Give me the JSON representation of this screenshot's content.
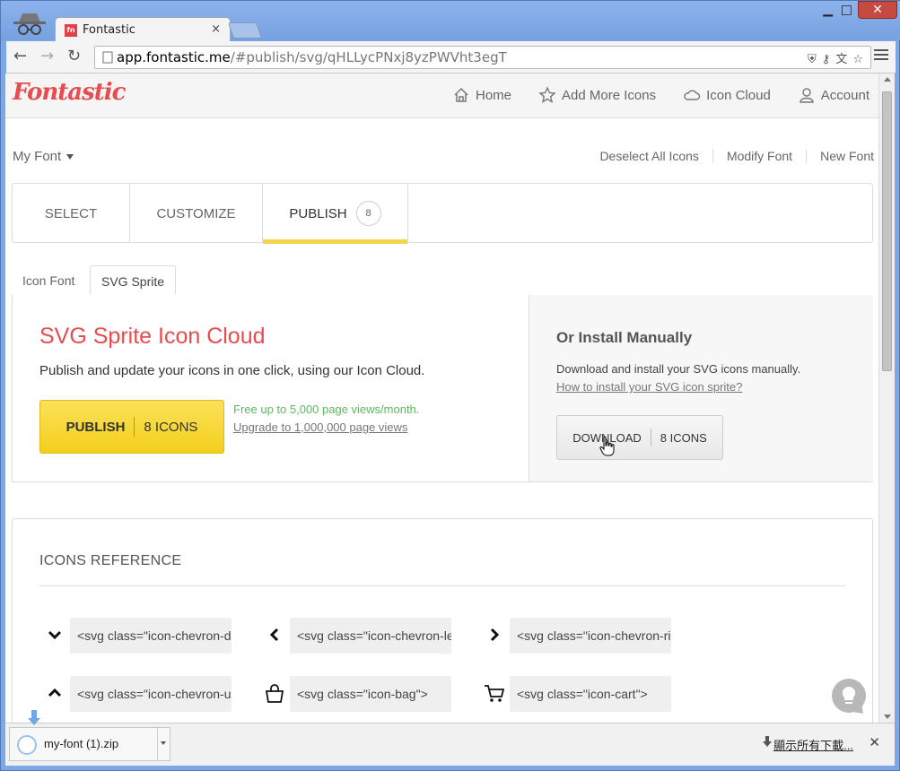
{
  "browser": {
    "tab_title": "Fontastic",
    "tab_favicon_text": "fn",
    "url_host": "app.fontastic.me",
    "url_path": "/#publish/svg/qHLLycPNxj8yzPWVht3egT"
  },
  "app": {
    "logo": "Fontastic",
    "nav": [
      {
        "label": "Home",
        "icon": "home-icon"
      },
      {
        "label": "Add More Icons",
        "icon": "star-icon"
      },
      {
        "label": "Icon Cloud",
        "icon": "cloud-icon"
      },
      {
        "label": "Account",
        "icon": "user-icon"
      }
    ],
    "font_name": "My Font",
    "font_actions": [
      "Deselect All Icons",
      "Modify Font",
      "New Font"
    ],
    "steps": [
      "SELECT",
      "CUSTOMIZE",
      "PUBLISH"
    ],
    "publish_badge": "8",
    "subtabs": [
      "Icon Font",
      "SVG Sprite"
    ],
    "cloud": {
      "title": "SVG Sprite Icon Cloud",
      "desc": "Publish and update your icons in one click, using our Icon Cloud.",
      "publish_label": "PUBLISH",
      "publish_count": "8 ICONS",
      "free_note": "Free up to 5,000 page views/month.",
      "upgrade_link": "Upgrade to 1,000,000 page views"
    },
    "manual": {
      "title": "Or Install Manually",
      "desc": "Download and install your SVG icons manually.",
      "link": "How to install your SVG icon sprite?",
      "download_label": "DOWNLOAD",
      "download_count": "8 ICONS"
    },
    "reference": {
      "title": "ICONS REFERENCE",
      "items": [
        {
          "icon": "chevron-down-icon",
          "code": "<svg class=\"icon-chevron-down\">"
        },
        {
          "icon": "chevron-left-icon",
          "code": "<svg class=\"icon-chevron-left\">"
        },
        {
          "icon": "chevron-right-icon",
          "code": "<svg class=\"icon-chevron-right\">"
        },
        {
          "icon": "chevron-up-icon",
          "code": "<svg class=\"icon-chevron-up\">"
        },
        {
          "icon": "bag-icon",
          "code": "<svg class=\"icon-bag\">"
        },
        {
          "icon": "cart-icon",
          "code": "<svg class=\"icon-cart\">"
        }
      ]
    }
  },
  "download_shelf": {
    "filename": "my-font (1).zip",
    "show_all": "顯示所有下載..."
  },
  "colors": {
    "brand_red": "#e84c4f",
    "accent_yellow": "#f4d54c",
    "success_green": "#5cb85c"
  }
}
